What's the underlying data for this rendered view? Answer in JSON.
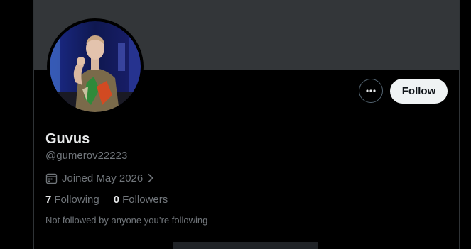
{
  "profile": {
    "display_name": "Guvus",
    "handle": "@gumerov22223",
    "joined": "Joined May 2026",
    "following_count": "7",
    "following_label": "Following",
    "followers_count": "0",
    "followers_label": "Followers",
    "followed_by_text": "Not followed by anyone you’re following"
  },
  "actions": {
    "follow_label": "Follow",
    "more_icon": "more-horizontal-icon"
  },
  "icons": {
    "calendar": "calendar-icon",
    "chevron": "chevron-right-icon"
  },
  "colors": {
    "background": "#000000",
    "banner": "#333639",
    "primary_text": "#e7e9ea",
    "secondary_text": "#71767b",
    "follow_button_bg": "#eff3f4",
    "follow_button_text": "#0f1419"
  }
}
